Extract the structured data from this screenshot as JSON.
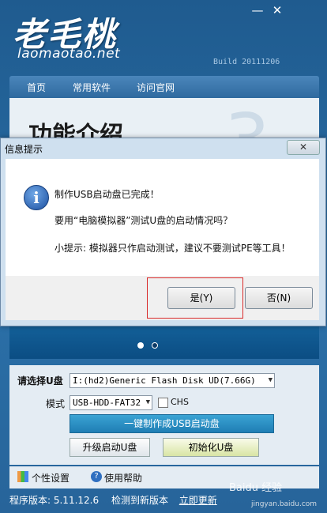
{
  "app": {
    "logo": "老毛桃",
    "site": "laomaotao.net",
    "build": "Build 20111206",
    "minimize": "—",
    "close": "✕",
    "tabs": [
      "首页",
      "常用软件",
      "访问官网"
    ],
    "feature_title": "功能介绍",
    "big_number": "3",
    "usb_label": "请选择U盘",
    "usb_value": "I:(hd2)Generic Flash Disk UD(7.66G)",
    "mode_label": "模式",
    "mode_value": "USB-HDD-FAT32",
    "chs_label": "CHS",
    "make_button": "一键制作成USB启动盘",
    "upgrade_button": "升级启动U盘",
    "init_button": "初始化U盘",
    "personal_settings": "个性设置",
    "help": "使用帮助",
    "version_text": "程序版本: 5.11.12.6",
    "new_version_text": "检测到新版本",
    "update_now": "立即更新"
  },
  "dialog": {
    "title": "信息提示",
    "close": "✕",
    "line1": "制作USB启动盘已完成！",
    "line2": "要用“电脑模拟器”测试U盘的启动情况吗？",
    "line3": "小提示: 模拟器只作启动测试，建议不要测试PE等工具！",
    "yes": "是(Y)",
    "no": "否(N)"
  },
  "watermark": {
    "text": "Baidu 经验",
    "url": "jingyan.baidu.com"
  }
}
